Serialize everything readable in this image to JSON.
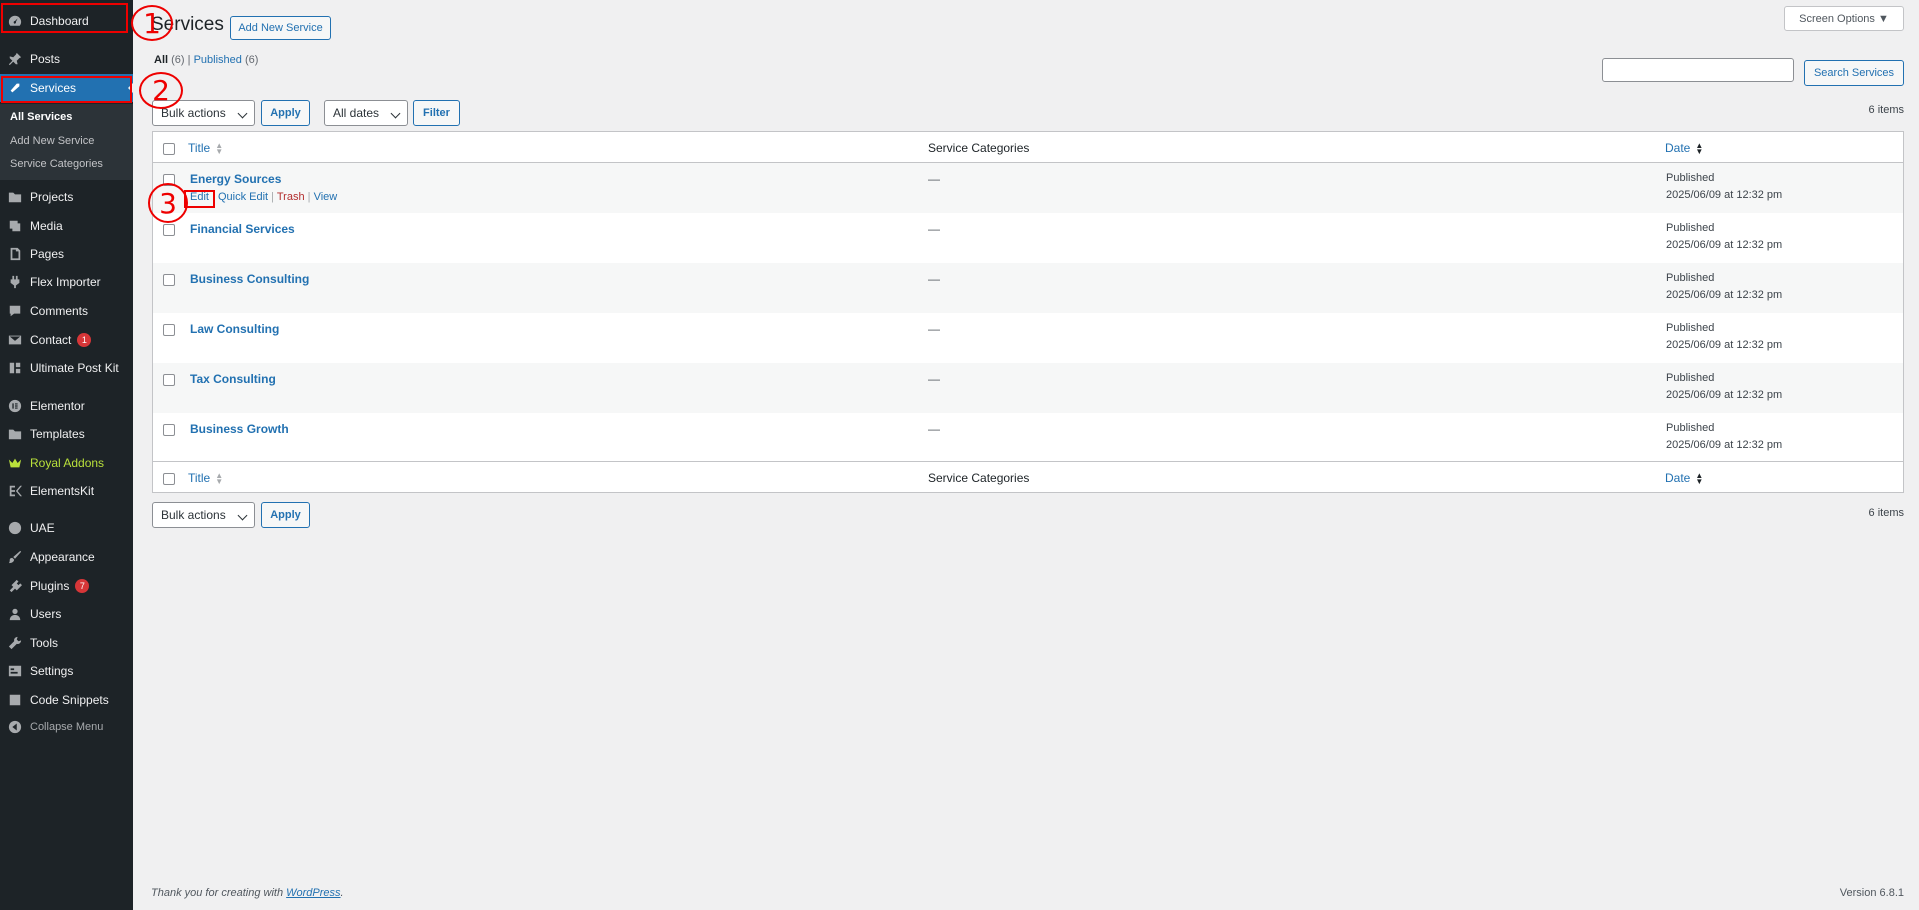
{
  "sidebar": {
    "items": [
      {
        "label": "Dashboard",
        "icon": "dashboard-icon"
      },
      {
        "label": "Posts",
        "icon": "pin-icon"
      },
      {
        "label": "Services",
        "icon": "wrench-icon"
      },
      {
        "label": "Projects",
        "icon": "folder-icon"
      },
      {
        "label": "Media",
        "icon": "media-icon"
      },
      {
        "label": "Pages",
        "icon": "page-icon"
      },
      {
        "label": "Flex Importer",
        "icon": "plug-icon"
      },
      {
        "label": "Comments",
        "icon": "comment-icon"
      },
      {
        "label": "Contact",
        "icon": "mail-icon",
        "badge": "1"
      },
      {
        "label": "Ultimate Post Kit",
        "icon": "grid-icon"
      },
      {
        "label": "Elementor",
        "icon": "elementor-icon"
      },
      {
        "label": "Templates",
        "icon": "folder-icon"
      },
      {
        "label": "Royal Addons",
        "icon": "crown-icon"
      },
      {
        "label": "ElementsKit",
        "icon": "ekit-icon"
      },
      {
        "label": "UAE",
        "icon": "uae-icon"
      },
      {
        "label": "Appearance",
        "icon": "brush-icon"
      },
      {
        "label": "Plugins",
        "icon": "plugin-icon",
        "badge": "7"
      },
      {
        "label": "Users",
        "icon": "user-icon"
      },
      {
        "label": "Tools",
        "icon": "tool-icon"
      },
      {
        "label": "Settings",
        "icon": "settings-icon"
      },
      {
        "label": "Code Snippets",
        "icon": "code-icon"
      },
      {
        "label": "Collapse Menu",
        "icon": "collapse-icon"
      }
    ],
    "submenu": [
      "All Services",
      "Add New Service",
      "Service Categories"
    ]
  },
  "header": {
    "title": "Services",
    "add_new": "Add New Service",
    "screen_options": "Screen Options ▼"
  },
  "filters": {
    "all_label": "All",
    "all_count": "(6)",
    "separator": "|",
    "published_label": "Published",
    "published_count": "(6)",
    "bulk_actions": "Bulk actions",
    "apply": "Apply",
    "all_dates": "All dates",
    "filter": "Filter",
    "search_button": "Search Services",
    "items_count": "6 items"
  },
  "table": {
    "col_title": "Title",
    "col_categories": "Service Categories",
    "col_date": "Date",
    "row_actions": {
      "edit": "Edit",
      "quick_edit": "Quick Edit",
      "trash": "Trash",
      "view": "View",
      "sep": "|"
    },
    "rows": [
      {
        "title": "Energy Sources",
        "category": "—",
        "status": "Published",
        "date": "2025/06/09 at 12:32 pm"
      },
      {
        "title": "Financial Services",
        "category": "—",
        "status": "Published",
        "date": "2025/06/09 at 12:32 pm"
      },
      {
        "title": "Business Consulting",
        "category": "—",
        "status": "Published",
        "date": "2025/06/09 at 12:32 pm"
      },
      {
        "title": "Law Consulting",
        "category": "—",
        "status": "Published",
        "date": "2025/06/09 at 12:32 pm"
      },
      {
        "title": "Tax Consulting",
        "category": "—",
        "status": "Published",
        "date": "2025/06/09 at 12:32 pm"
      },
      {
        "title": "Business Growth",
        "category": "—",
        "status": "Published",
        "date": "2025/06/09 at 12:32 pm"
      }
    ]
  },
  "annotations": [
    "1",
    "2",
    "3"
  ],
  "footer": {
    "thanks_prefix": "Thank you for creating with",
    "wordpress": "WordPress",
    "thanks_suffix": ".",
    "version": "Version 6.8.1"
  },
  "colors": {
    "sidebar_bg": "#1d2327",
    "accent": "#2271b1",
    "annotation": "#ee0000",
    "royal": "#b9e13b"
  }
}
